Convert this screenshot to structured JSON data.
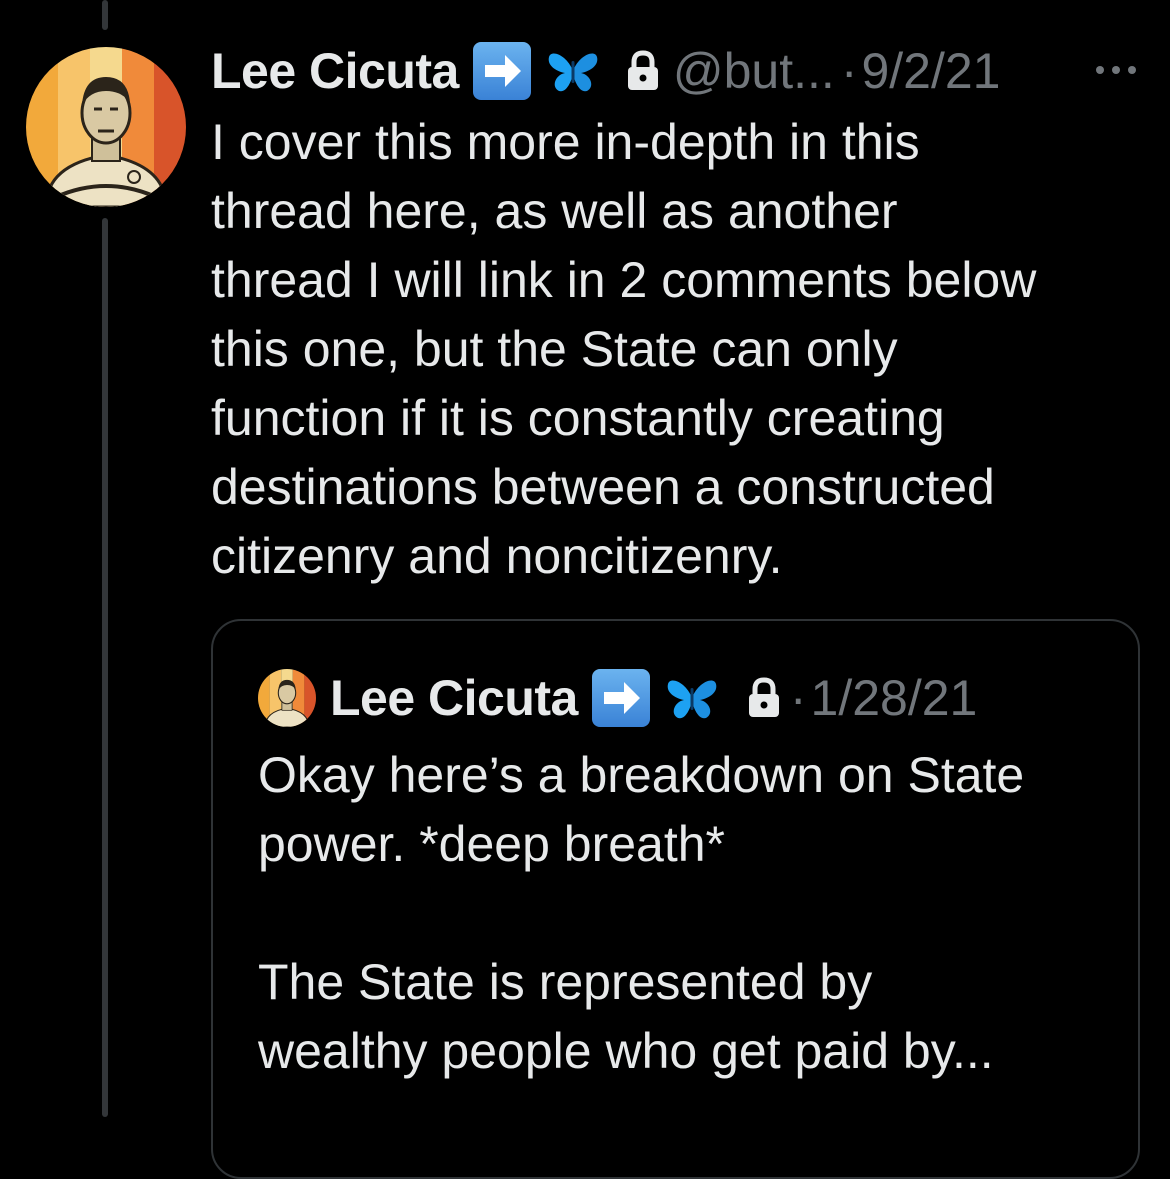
{
  "tweet": {
    "author_name": "Lee Cicuta",
    "handle": "@but...",
    "separator": "·",
    "date": "9/2/21",
    "text": "I cover this more in-depth in this\nthread here, as well as another\nthread I will link in 2 comments below\nthis one, but the State can only\nfunction if it is constantly creating\ndestinations between a constructed\ncitizenry and noncitizenry.",
    "badges": [
      "right-arrow-emoji-icon",
      "butterfly-emoji-icon",
      "lock-icon"
    ],
    "more_icon": "more-horizontal-icon"
  },
  "quoted_tweet": {
    "author_name": "Lee Cicuta",
    "separator": "·",
    "date": "1/28/21",
    "text": "Okay here’s a breakdown on State\npower. *deep breath*\n\nThe State is represented by\nwealthy people who get paid by..."
  },
  "colors": {
    "background": "#000000",
    "text_primary": "#e7e9ea",
    "text_secondary": "#71767b",
    "border": "#2f3336",
    "thread_line": "#333639",
    "emoji_blue": "#3a82d6",
    "butterfly_blue": "#1da1f2"
  }
}
